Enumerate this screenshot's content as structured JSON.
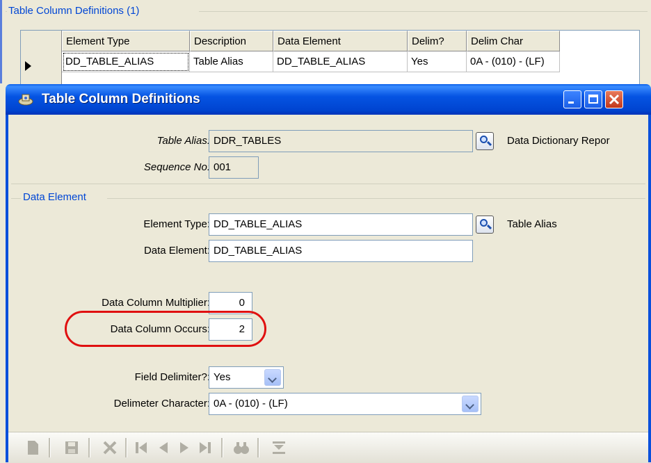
{
  "parent": {
    "group_title": "Table Column Definitions  (1)",
    "grid": {
      "columns": [
        "Element Type",
        "Description",
        "Data Element",
        "Delim?",
        "Delim Char"
      ],
      "rows": [
        [
          "DD_TABLE_ALIAS",
          "Table Alias",
          "DD_TABLE_ALIAS",
          "Yes",
          "0A - (010) - (LF)"
        ]
      ]
    }
  },
  "dialog": {
    "title": "Table Column Definitions",
    "title_icon": "app-icon",
    "window_buttons": [
      "minimize-icon",
      "maximize-icon",
      "close-icon"
    ],
    "table_alias": {
      "label": "Table Alias:",
      "value": "DDR_TABLES",
      "description": "Data Dictionary Repor"
    },
    "sequence_no": {
      "label": "Sequence No:",
      "value": "001"
    },
    "data_element_group": {
      "title": "Data Element",
      "element_type": {
        "label": "Element Type:",
        "value": "DD_TABLE_ALIAS",
        "description": "Table Alias"
      },
      "data_element": {
        "label": "Data Element:",
        "value": "DD_TABLE_ALIAS"
      }
    },
    "data_column_multiplier": {
      "label": "Data Column Multiplier:",
      "value": "0"
    },
    "data_column_occurs": {
      "label": "Data Column Occurs:",
      "value": "2"
    },
    "field_delimiter": {
      "label": "Field Delimiter?:",
      "value": "Yes"
    },
    "delimiter_character": {
      "label": "Delimeter Character:",
      "value": "0A - (010) - (LF)"
    },
    "toolbar": [
      "new-icon",
      "save-icon",
      "delete-icon",
      "first-record-icon",
      "previous-record-icon",
      "next-record-icon",
      "last-record-icon",
      "find-icon",
      "filter-icon"
    ],
    "highlight_color": "#e01010",
    "title_bar_color": "#0054e3"
  }
}
